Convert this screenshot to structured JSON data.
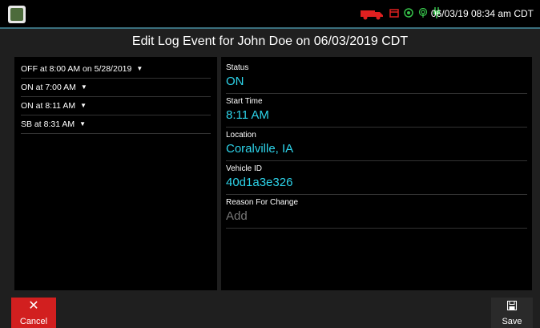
{
  "status_bar": {
    "datetime": "06/03/19 08:34 am CDT",
    "icons": [
      "truck-icon",
      "calendar-icon",
      "gps-icon",
      "wireless-icon",
      "plug-icon"
    ]
  },
  "title": "Edit Log Event for John Doe on 06/03/2019 CDT",
  "events": [
    {
      "label": "OFF at 8:00 AM on 5/28/2019"
    },
    {
      "label": "ON at 7:00 AM"
    },
    {
      "label": "ON at 8:11 AM"
    },
    {
      "label": "SB at 8:31 AM"
    }
  ],
  "details": {
    "status": {
      "label": "Status",
      "value": "ON"
    },
    "start_time": {
      "label": "Start Time",
      "value": "8:11 AM"
    },
    "location": {
      "label": "Location",
      "value": "Coralville, IA"
    },
    "vehicle_id": {
      "label": "Vehicle ID",
      "value": "40d1a3e326"
    },
    "reason": {
      "label": "Reason For Change",
      "placeholder": "Add"
    }
  },
  "buttons": {
    "cancel": "Cancel",
    "save": "Save"
  },
  "colors": {
    "accent": "#2dd4ea",
    "cancel": "#d21f1f",
    "status_icons": "#e02020"
  }
}
